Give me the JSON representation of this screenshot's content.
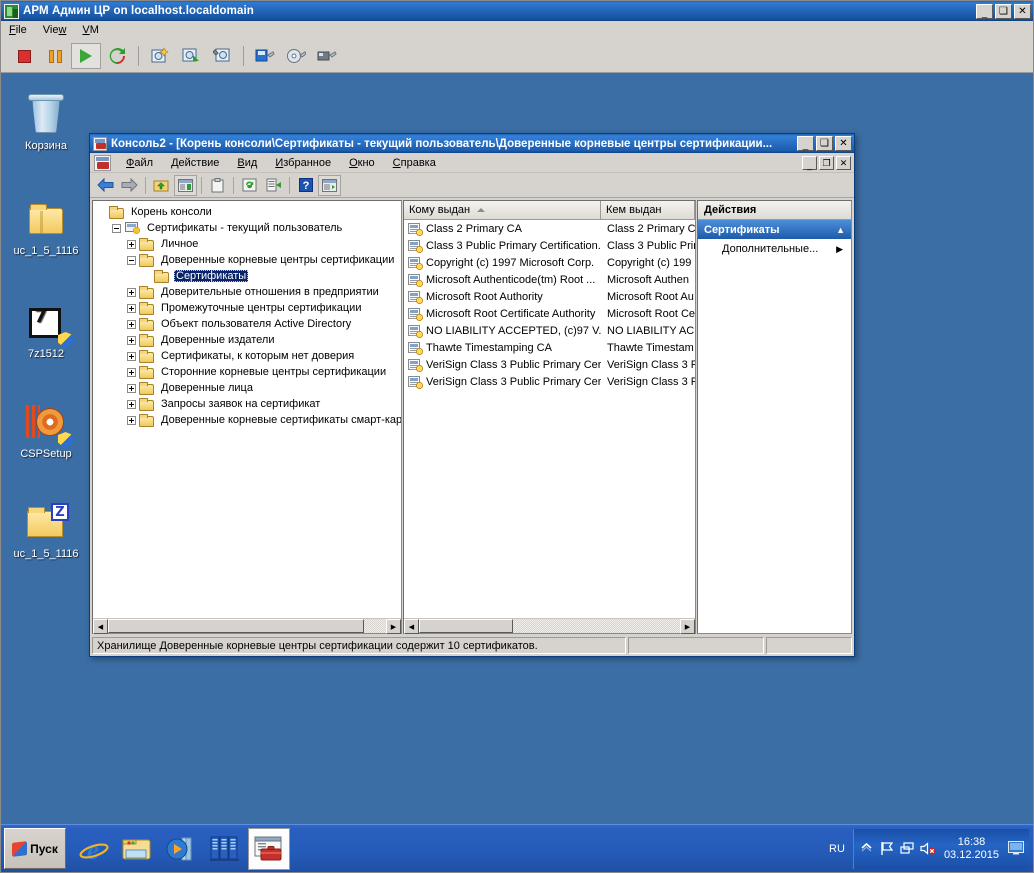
{
  "vm_window": {
    "title": "АРМ Админ ЦР on localhost.localdomain",
    "icon": "vmware-icon",
    "menus": [
      "File",
      "View",
      "VM"
    ],
    "controls": {
      "minimize": "_",
      "maximize": "□",
      "close": "✕"
    },
    "toolbar": [
      {
        "name": "power-off-button",
        "label": "Power Off"
      },
      {
        "name": "suspend-button",
        "label": "Suspend"
      },
      {
        "name": "power-on-button",
        "label": "Power On",
        "selected": true
      },
      {
        "name": "reset-button",
        "label": "Reset"
      },
      {
        "name": "snapshot-take-button",
        "label": "Take Snapshot"
      },
      {
        "name": "snapshot-revert-button",
        "label": "Revert Snapshot"
      },
      {
        "name": "snapshot-manager-button",
        "label": "Snapshot Manager"
      },
      {
        "name": "vm-settings-button",
        "label": "VM Settings"
      },
      {
        "name": "cd-settings-button",
        "label": "CD/DVD Settings"
      },
      {
        "name": "usb-settings-button",
        "label": "USB Settings"
      }
    ]
  },
  "desktop": {
    "background_color": "#3b6ea5",
    "icons": [
      {
        "name": "desktop-icon-recycle-bin",
        "label": "Корзина",
        "glyph": "recycle-bin-icon"
      },
      {
        "name": "desktop-icon-uc-folder",
        "label": "uc_1_5_1116",
        "glyph": "folder-icon"
      },
      {
        "name": "desktop-icon-7z1512",
        "label": "7z1512",
        "glyph": "sevenzip-installer-icon"
      },
      {
        "name": "desktop-icon-cspsetup",
        "label": "CSPSetup",
        "glyph": "cd-installer-icon"
      },
      {
        "name": "desktop-icon-uc-zip",
        "label": "uc_1_5_1116",
        "glyph": "zip-folder-icon"
      }
    ]
  },
  "mmc": {
    "title": "Консоль2 - [Корень консоли\\Сертификаты - текущий пользователь\\Доверенные корневые центры сертификации...",
    "icon": "mmc-console-icon",
    "window_controls": {
      "minimize": "_",
      "maximize": "□",
      "close": "✕"
    },
    "mdi_controls": {
      "minimize": "_",
      "restore": "❐",
      "close": "✕"
    },
    "menus": [
      {
        "name": "menu-file",
        "label": "Файл",
        "accel": "Ф"
      },
      {
        "name": "menu-action",
        "label": "Действие",
        "accel": "Д"
      },
      {
        "name": "menu-view",
        "label": "Вид",
        "accel": "В"
      },
      {
        "name": "menu-favorites",
        "label": "Избранное",
        "accel": "И"
      },
      {
        "name": "menu-window",
        "label": "Окно",
        "accel": "О"
      },
      {
        "name": "menu-help",
        "label": "Справка",
        "accel": "С"
      }
    ],
    "toolbar": [
      {
        "name": "back-button",
        "glyph": "arrow-left-icon"
      },
      {
        "name": "forward-button",
        "glyph": "arrow-right-icon"
      },
      {
        "name": "up-one-level-button",
        "glyph": "folder-up-icon"
      },
      {
        "name": "show-hide-tree-button",
        "glyph": "console-tree-icon"
      },
      {
        "name": "copy-button",
        "glyph": "clipboard-icon"
      },
      {
        "name": "refresh-button",
        "glyph": "refresh-icon"
      },
      {
        "name": "export-list-button",
        "glyph": "export-icon"
      },
      {
        "name": "help-button",
        "glyph": "question-mark-icon"
      },
      {
        "name": "show-action-pane-button",
        "glyph": "action-pane-icon"
      }
    ],
    "tree": [
      {
        "label": "Корень консоли",
        "depth": 0,
        "expander": "none",
        "icon": "folder-icon",
        "selected": false
      },
      {
        "label": "Сертификаты - текущий пользователь",
        "depth": 1,
        "expander": "minus",
        "icon": "cert-store-icon",
        "selected": false
      },
      {
        "label": "Личное",
        "depth": 2,
        "expander": "plus",
        "icon": "folder-icon",
        "selected": false
      },
      {
        "label": "Доверенные корневые центры сертификации",
        "depth": 2,
        "expander": "minus",
        "icon": "folder-icon",
        "selected": false
      },
      {
        "label": "Сертификаты",
        "depth": 3,
        "expander": "none",
        "icon": "folder-icon",
        "selected": true
      },
      {
        "label": "Доверительные отношения в предприятии",
        "depth": 2,
        "expander": "plus",
        "icon": "folder-icon",
        "selected": false
      },
      {
        "label": "Промежуточные центры сертификации",
        "depth": 2,
        "expander": "plus",
        "icon": "folder-icon",
        "selected": false
      },
      {
        "label": "Объект пользователя Active Directory",
        "depth": 2,
        "expander": "plus",
        "icon": "folder-icon",
        "selected": false
      },
      {
        "label": "Доверенные издатели",
        "depth": 2,
        "expander": "plus",
        "icon": "folder-icon",
        "selected": false
      },
      {
        "label": "Сертификаты, к которым нет доверия",
        "depth": 2,
        "expander": "plus",
        "icon": "folder-icon",
        "selected": false
      },
      {
        "label": "Сторонние корневые центры сертификации",
        "depth": 2,
        "expander": "plus",
        "icon": "folder-icon",
        "selected": false
      },
      {
        "label": "Доверенные лица",
        "depth": 2,
        "expander": "plus",
        "icon": "folder-icon",
        "selected": false
      },
      {
        "label": "Запросы заявок на сертификат",
        "depth": 2,
        "expander": "plus",
        "icon": "folder-icon",
        "selected": false
      },
      {
        "label": "Доверенные корневые сертификаты смарт-кар",
        "depth": 2,
        "expander": "plus",
        "icon": "folder-icon",
        "selected": false
      }
    ],
    "list": {
      "columns": [
        {
          "name": "column-issued-to",
          "label": "Кому выдан",
          "sort": "asc"
        },
        {
          "name": "column-issued-by",
          "label": "Кем выдан",
          "sort": "none"
        }
      ],
      "rows": [
        {
          "issued_to": "Class 2 Primary CA",
          "issued_by": "Class 2 Primary C"
        },
        {
          "issued_to": "Class 3 Public Primary Certification...",
          "issued_by": "Class 3 Public Prin"
        },
        {
          "issued_to": "Copyright (c) 1997 Microsoft Corp.",
          "issued_by": "Copyright (c) 199"
        },
        {
          "issued_to": "Microsoft Authenticode(tm) Root ...",
          "issued_by": "Microsoft Authen"
        },
        {
          "issued_to": "Microsoft Root Authority",
          "issued_by": "Microsoft Root Au"
        },
        {
          "issued_to": "Microsoft Root Certificate Authority",
          "issued_by": "Microsoft Root Ce"
        },
        {
          "issued_to": "NO LIABILITY ACCEPTED, (c)97 V...",
          "issued_by": "NO LIABILITY AC"
        },
        {
          "issued_to": "Thawte Timestamping CA",
          "issued_by": "Thawte Timestam"
        },
        {
          "issued_to": "VeriSign Class 3 Public Primary Cer...",
          "issued_by": "VeriSign Class 3 P"
        },
        {
          "issued_to": "VeriSign Class 3 Public Primary Cer...",
          "issued_by": "VeriSign Class 3 P"
        }
      ]
    },
    "actions": {
      "header": "Действия",
      "group": "Сертификаты",
      "group_chevron": "▲",
      "items": [
        {
          "name": "action-more",
          "label": "Дополнительные...",
          "arrow": "▶"
        }
      ]
    },
    "status": {
      "main": "Хранилище Доверенные корневые центры сертификации содержит 10 сертификатов.",
      "panel2": "",
      "panel3": ""
    }
  },
  "taskbar": {
    "start_label": "Пуск",
    "quick_launch": [
      {
        "name": "taskbar-internet-explorer",
        "glyph": "internet-explorer-icon",
        "active": false
      },
      {
        "name": "taskbar-explorer",
        "glyph": "folder-explorer-icon",
        "active": false
      },
      {
        "name": "taskbar-media-player",
        "glyph": "media-player-icon",
        "active": false
      },
      {
        "name": "taskbar-server-manager",
        "glyph": "server-manager-icon",
        "active": false
      },
      {
        "name": "taskbar-mmc-console",
        "glyph": "mmc-console-icon",
        "active": true
      }
    ],
    "tray": {
      "language": "RU",
      "icons": [
        {
          "name": "tray-show-hidden-icon",
          "glyph": "chevron-up-icon"
        },
        {
          "name": "tray-flag-icon",
          "glyph": "flag-icon"
        },
        {
          "name": "tray-network-icon",
          "glyph": "network-icon"
        },
        {
          "name": "tray-volume-muted-icon",
          "glyph": "speaker-muted-icon"
        }
      ],
      "time": "16:38",
      "date": "03.12.2015",
      "show_desktop": "show-desktop-icon"
    }
  }
}
